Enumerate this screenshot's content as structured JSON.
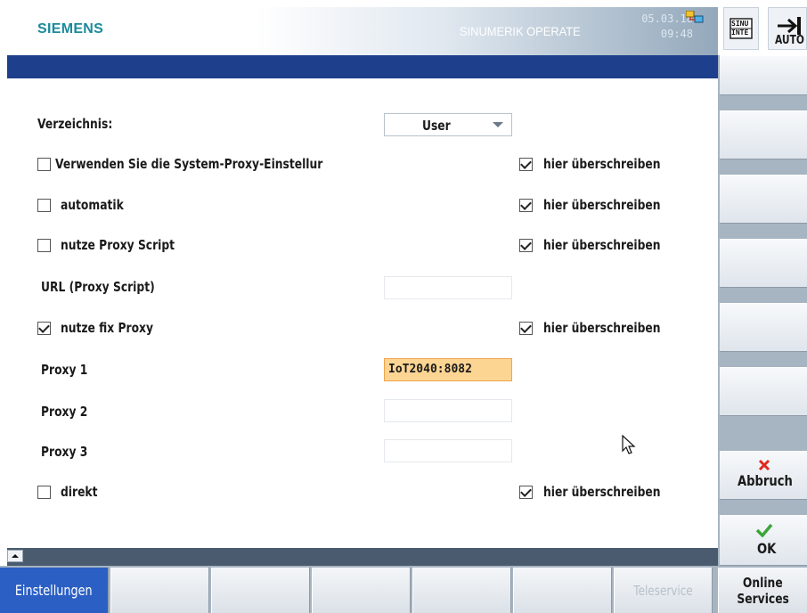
{
  "header": {
    "brand": "SIEMENS",
    "product": "SINUMERIK OPERATE",
    "date": "05.03.18",
    "time": "09:48",
    "accent_color": "#1d3f8c"
  },
  "top_buttons": [
    {
      "label_top": "SINU",
      "label_bottom": "INTE",
      "icon": "hmi-icon"
    },
    {
      "label": "AUTO",
      "icon": "auto-mode-icon"
    }
  ],
  "form": {
    "directory_label": "Verzeichnis:",
    "directory_value": "User",
    "system_proxy": {
      "label": "Verwenden Sie die System-Proxy-Einstellur",
      "checked": false,
      "override_label": "hier überschreiben",
      "override_checked": true
    },
    "automatic": {
      "label": "automatik",
      "checked": false,
      "override_label": "hier überschreiben",
      "override_checked": true
    },
    "proxy_script": {
      "label": "nutze Proxy Script",
      "checked": false,
      "override_label": "hier überschreiben",
      "override_checked": true
    },
    "url_label": "URL (Proxy Script)",
    "url_value": "",
    "fix_proxy": {
      "label": "nutze fix Proxy",
      "checked": true,
      "override_label": "hier überschreiben",
      "override_checked": true
    },
    "proxy1_label": "Proxy 1",
    "proxy1_value": "IoT2040:8082",
    "proxy2_label": "Proxy 2",
    "proxy2_value": "",
    "proxy3_label": "Proxy 3",
    "proxy3_value": "",
    "direct": {
      "label": "direkt",
      "checked": false,
      "override_label": "hier überschreiben",
      "override_checked": true
    }
  },
  "right_softkeys": {
    "cancel": "Abbruch",
    "ok": "OK"
  },
  "bottom_softkeys": {
    "settings": "Einstellungen",
    "teleservice": "Teleservice",
    "online_services_line1": "Online",
    "online_services_line2": "Services"
  }
}
